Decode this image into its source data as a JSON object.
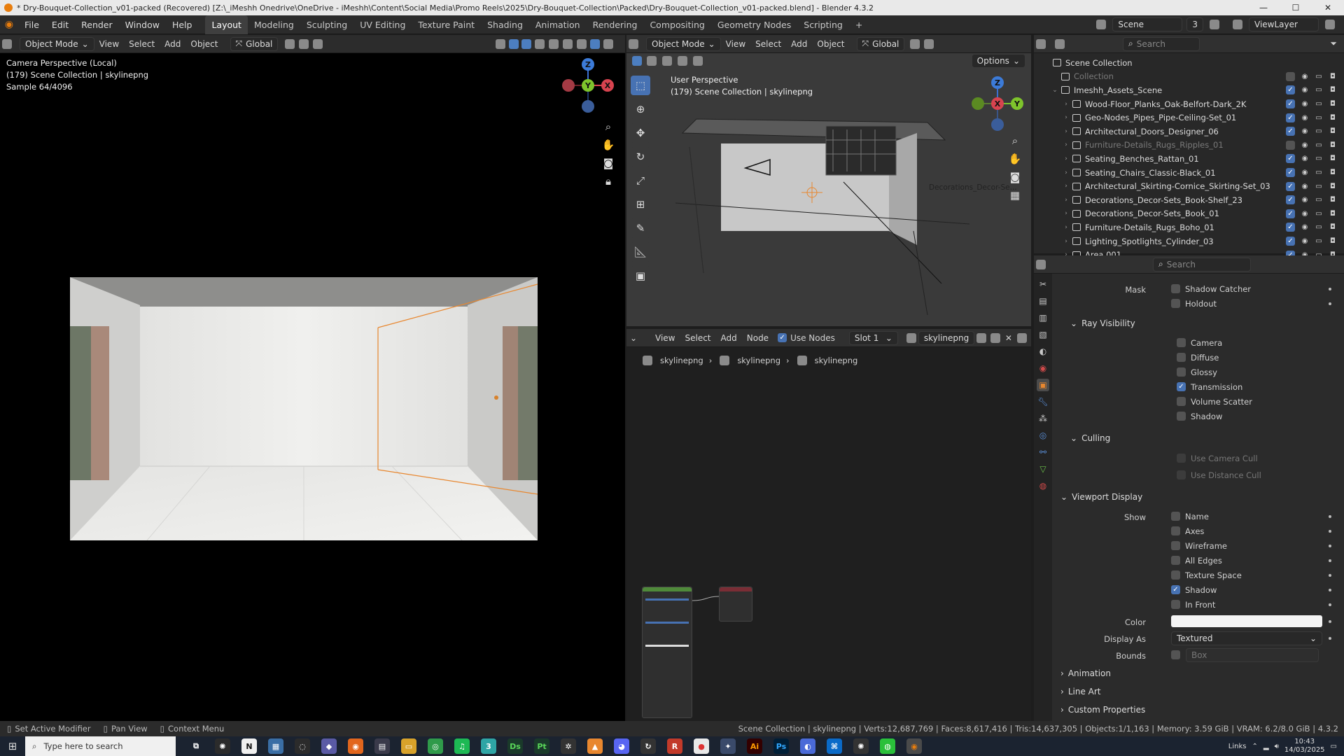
{
  "window": {
    "title": "* Dry-Bouquet-Collection_v01-packed (Recovered) [Z:\\_iMeshh Onedrive\\OneDrive - iMeshh\\Content\\Social Media\\Promo Reels\\2025\\Dry-Bouquet-Collection\\Packed\\Dry-Bouquet-Collection_v01-packed.blend] - Blender 4.3.2"
  },
  "menu": [
    "File",
    "Edit",
    "Render",
    "Window",
    "Help"
  ],
  "workspaces": [
    "Layout",
    "Modeling",
    "Sculpting",
    "UV Editing",
    "Texture Paint",
    "Shading",
    "Animation",
    "Rendering",
    "Compositing",
    "Geometry Nodes",
    "Scripting"
  ],
  "topright": {
    "scene": "Scene",
    "scene_count": "3",
    "view_layer": "ViewLayer"
  },
  "left_viewport": {
    "mode": "Object Mode",
    "menus": [
      "View",
      "Select",
      "Add",
      "Object"
    ],
    "orientation": "Global",
    "line1": "Camera Perspective (Local)",
    "line2": "(179) Scene Collection | skylinepng",
    "line3": "Sample 64/4096"
  },
  "right_viewport": {
    "mode": "Object Mode",
    "menus": [
      "View",
      "Select",
      "Add",
      "Object"
    ],
    "orientation": "Global",
    "options": "Options",
    "line1": "User Perspective",
    "line2": "(179) Scene Collection | skylinepng",
    "object_label": "Decorations_Decor-Se..."
  },
  "gizmo": {
    "x": "X",
    "y": "Y",
    "z": "Z"
  },
  "node_editor": {
    "menus": [
      "View",
      "Select",
      "Add",
      "Node"
    ],
    "use_nodes": "Use Nodes",
    "slot": "Slot 1",
    "material": "skylinepng",
    "breadcrumb": [
      "skylinepng",
      "skylinepng",
      "skylinepng"
    ]
  },
  "outliner": {
    "search_placeholder": "Search",
    "root": "Scene Collection",
    "items": [
      {
        "name": "Collection",
        "depth": 1,
        "dim": true
      },
      {
        "name": "Imeshh_Assets_Scene",
        "depth": 1,
        "dim": false
      },
      {
        "name": "Wood-Floor_Planks_Oak-Belfort-Dark_2K",
        "depth": 2,
        "dim": false
      },
      {
        "name": "Geo-Nodes_Pipes_Pipe-Ceiling-Set_01",
        "depth": 2,
        "dim": false
      },
      {
        "name": "Architectural_Doors_Designer_06",
        "depth": 2,
        "dim": false
      },
      {
        "name": "Furniture-Details_Rugs_Ripples_01",
        "depth": 2,
        "dim": true
      },
      {
        "name": "Seating_Benches_Rattan_01",
        "depth": 2,
        "dim": false
      },
      {
        "name": "Seating_Chairs_Classic-Black_01",
        "depth": 2,
        "dim": false
      },
      {
        "name": "Architectural_Skirting-Cornice_Skirting-Set_03",
        "depth": 2,
        "dim": false
      },
      {
        "name": "Decorations_Decor-Sets_Book-Shelf_23",
        "depth": 2,
        "dim": false
      },
      {
        "name": "Decorations_Decor-Sets_Book_01",
        "depth": 2,
        "dim": false
      },
      {
        "name": "Furniture-Details_Rugs_Boho_01",
        "depth": 2,
        "dim": false
      },
      {
        "name": "Lighting_Spotlights_Cylinder_03",
        "depth": 2,
        "dim": false
      },
      {
        "name": "Area.001",
        "depth": 2,
        "dim": false
      }
    ]
  },
  "properties": {
    "search_placeholder": "Search",
    "mask_label": "Mask",
    "shadow_catcher": "Shadow Catcher",
    "holdout": "Holdout",
    "ray_visibility": "Ray Visibility",
    "ray_items": [
      {
        "label": "Camera",
        "checked": false
      },
      {
        "label": "Diffuse",
        "checked": false
      },
      {
        "label": "Glossy",
        "checked": false
      },
      {
        "label": "Transmission",
        "checked": true
      },
      {
        "label": "Volume Scatter",
        "checked": false
      },
      {
        "label": "Shadow",
        "checked": false
      }
    ],
    "culling": "Culling",
    "use_camera_cull": "Use Camera Cull",
    "use_distance_cull": "Use Distance Cull",
    "viewport_display": "Viewport Display",
    "show_label": "Show",
    "show_items": [
      {
        "label": "Name",
        "checked": false
      },
      {
        "label": "Axes",
        "checked": false
      },
      {
        "label": "Wireframe",
        "checked": false
      },
      {
        "label": "All Edges",
        "checked": false
      },
      {
        "label": "Texture Space",
        "checked": false
      },
      {
        "label": "Shadow",
        "checked": true
      },
      {
        "label": "In Front",
        "checked": false
      }
    ],
    "color_label": "Color",
    "display_as_label": "Display As",
    "display_as_value": "Textured",
    "bounds_label": "Bounds",
    "bounds_value": "Box",
    "collapsed": [
      "Animation",
      "Line Art",
      "Custom Properties"
    ]
  },
  "status": {
    "set_active_modifier": "Set Active Modifier",
    "pan_view": "Pan View",
    "context_menu": "Context Menu",
    "stats": "Scene Collection | skylinepng | Verts:12,687,769 | Faces:8,617,416 | Tris:14,637,305 | Objects:1/1,163 | Memory: 3.59 GiB | VRAM: 6.2/8.0 GiB | 4.3.2"
  },
  "taskbar": {
    "search_placeholder": "Type here to search",
    "links": "Links",
    "time": "10:43",
    "date": "14/03/2025"
  },
  "colors": {
    "accent": "#4772b3",
    "selection_orange": "#e8872f"
  }
}
